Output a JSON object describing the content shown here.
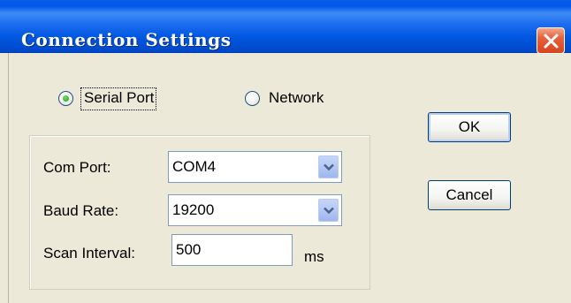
{
  "window": {
    "title": "Connection Settings",
    "close_icon": "close-icon"
  },
  "connection_type": {
    "options": [
      "Serial Port",
      "Network"
    ],
    "selected": "Serial Port"
  },
  "serial": {
    "com_port_label": "Com Port:",
    "com_port_value": "COM4",
    "baud_rate_label": "Baud Rate:",
    "baud_rate_value": "19200",
    "scan_interval_label": "Scan Interval:",
    "scan_interval_value": "500",
    "scan_interval_unit": "ms"
  },
  "buttons": {
    "ok": "OK",
    "cancel": "Cancel"
  },
  "colors": {
    "titlebar": "#0058ee",
    "close_button": "#e4603c",
    "dialog_background": "#ece9d8",
    "radio_selected": "#21a121"
  }
}
